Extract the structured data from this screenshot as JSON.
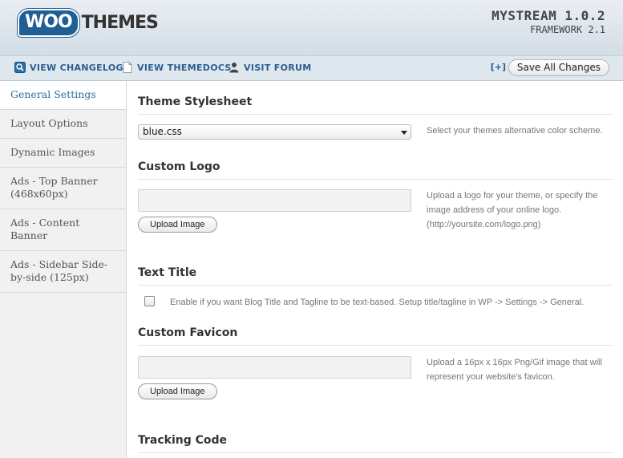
{
  "header": {
    "logo_woo": "WOO",
    "logo_themes": "THEMES",
    "version_title": "MYSTREAM 1.0.2",
    "version_sub": "FRAMEWORK 2.1"
  },
  "toolbar": {
    "changelog_label": "VIEW CHANGELOG",
    "themedocs_label": "VIEW THEMEDOCS",
    "forum_label": "VISIT FORUM",
    "expand_label": "[+]",
    "save_label": "Save All Changes",
    "icons": [
      "magnifier-icon",
      "document-icon",
      "person-icon"
    ]
  },
  "sidebar": {
    "items": [
      {
        "label": "General Settings",
        "active": true
      },
      {
        "label": "Layout Options"
      },
      {
        "label": "Dynamic Images"
      },
      {
        "label": "Ads - Top Banner (468x60px)"
      },
      {
        "label": "Ads - Content Banner"
      },
      {
        "label": "Ads - Sidebar Side-by-side (125px)"
      }
    ]
  },
  "main": {
    "stylesheet": {
      "title": "Theme Stylesheet",
      "selected": "blue.css",
      "help": "Select your themes alternative color scheme."
    },
    "logo": {
      "title": "Custom Logo",
      "value": "",
      "upload_label": "Upload Image",
      "help": "Upload a logo for your theme, or specify the image address of your online logo. (http://yoursite.com/logo.png)"
    },
    "text_title": {
      "title": "Text Title",
      "checked": false,
      "help": "Enable if you want Blog Title and Tagline to be text-based. Setup title/tagline in WP -> Settings -> General."
    },
    "favicon": {
      "title": "Custom Favicon",
      "value": "",
      "upload_label": "Upload Image",
      "help": "Upload a 16px x 16px Png/Gif image that will represent your website's favicon."
    },
    "tracking": {
      "title": "Tracking Code"
    }
  },
  "colors": {
    "accent": "#2a5d8f",
    "logo_blue": "#1f5f94",
    "header_bg": "#d3dde6"
  }
}
